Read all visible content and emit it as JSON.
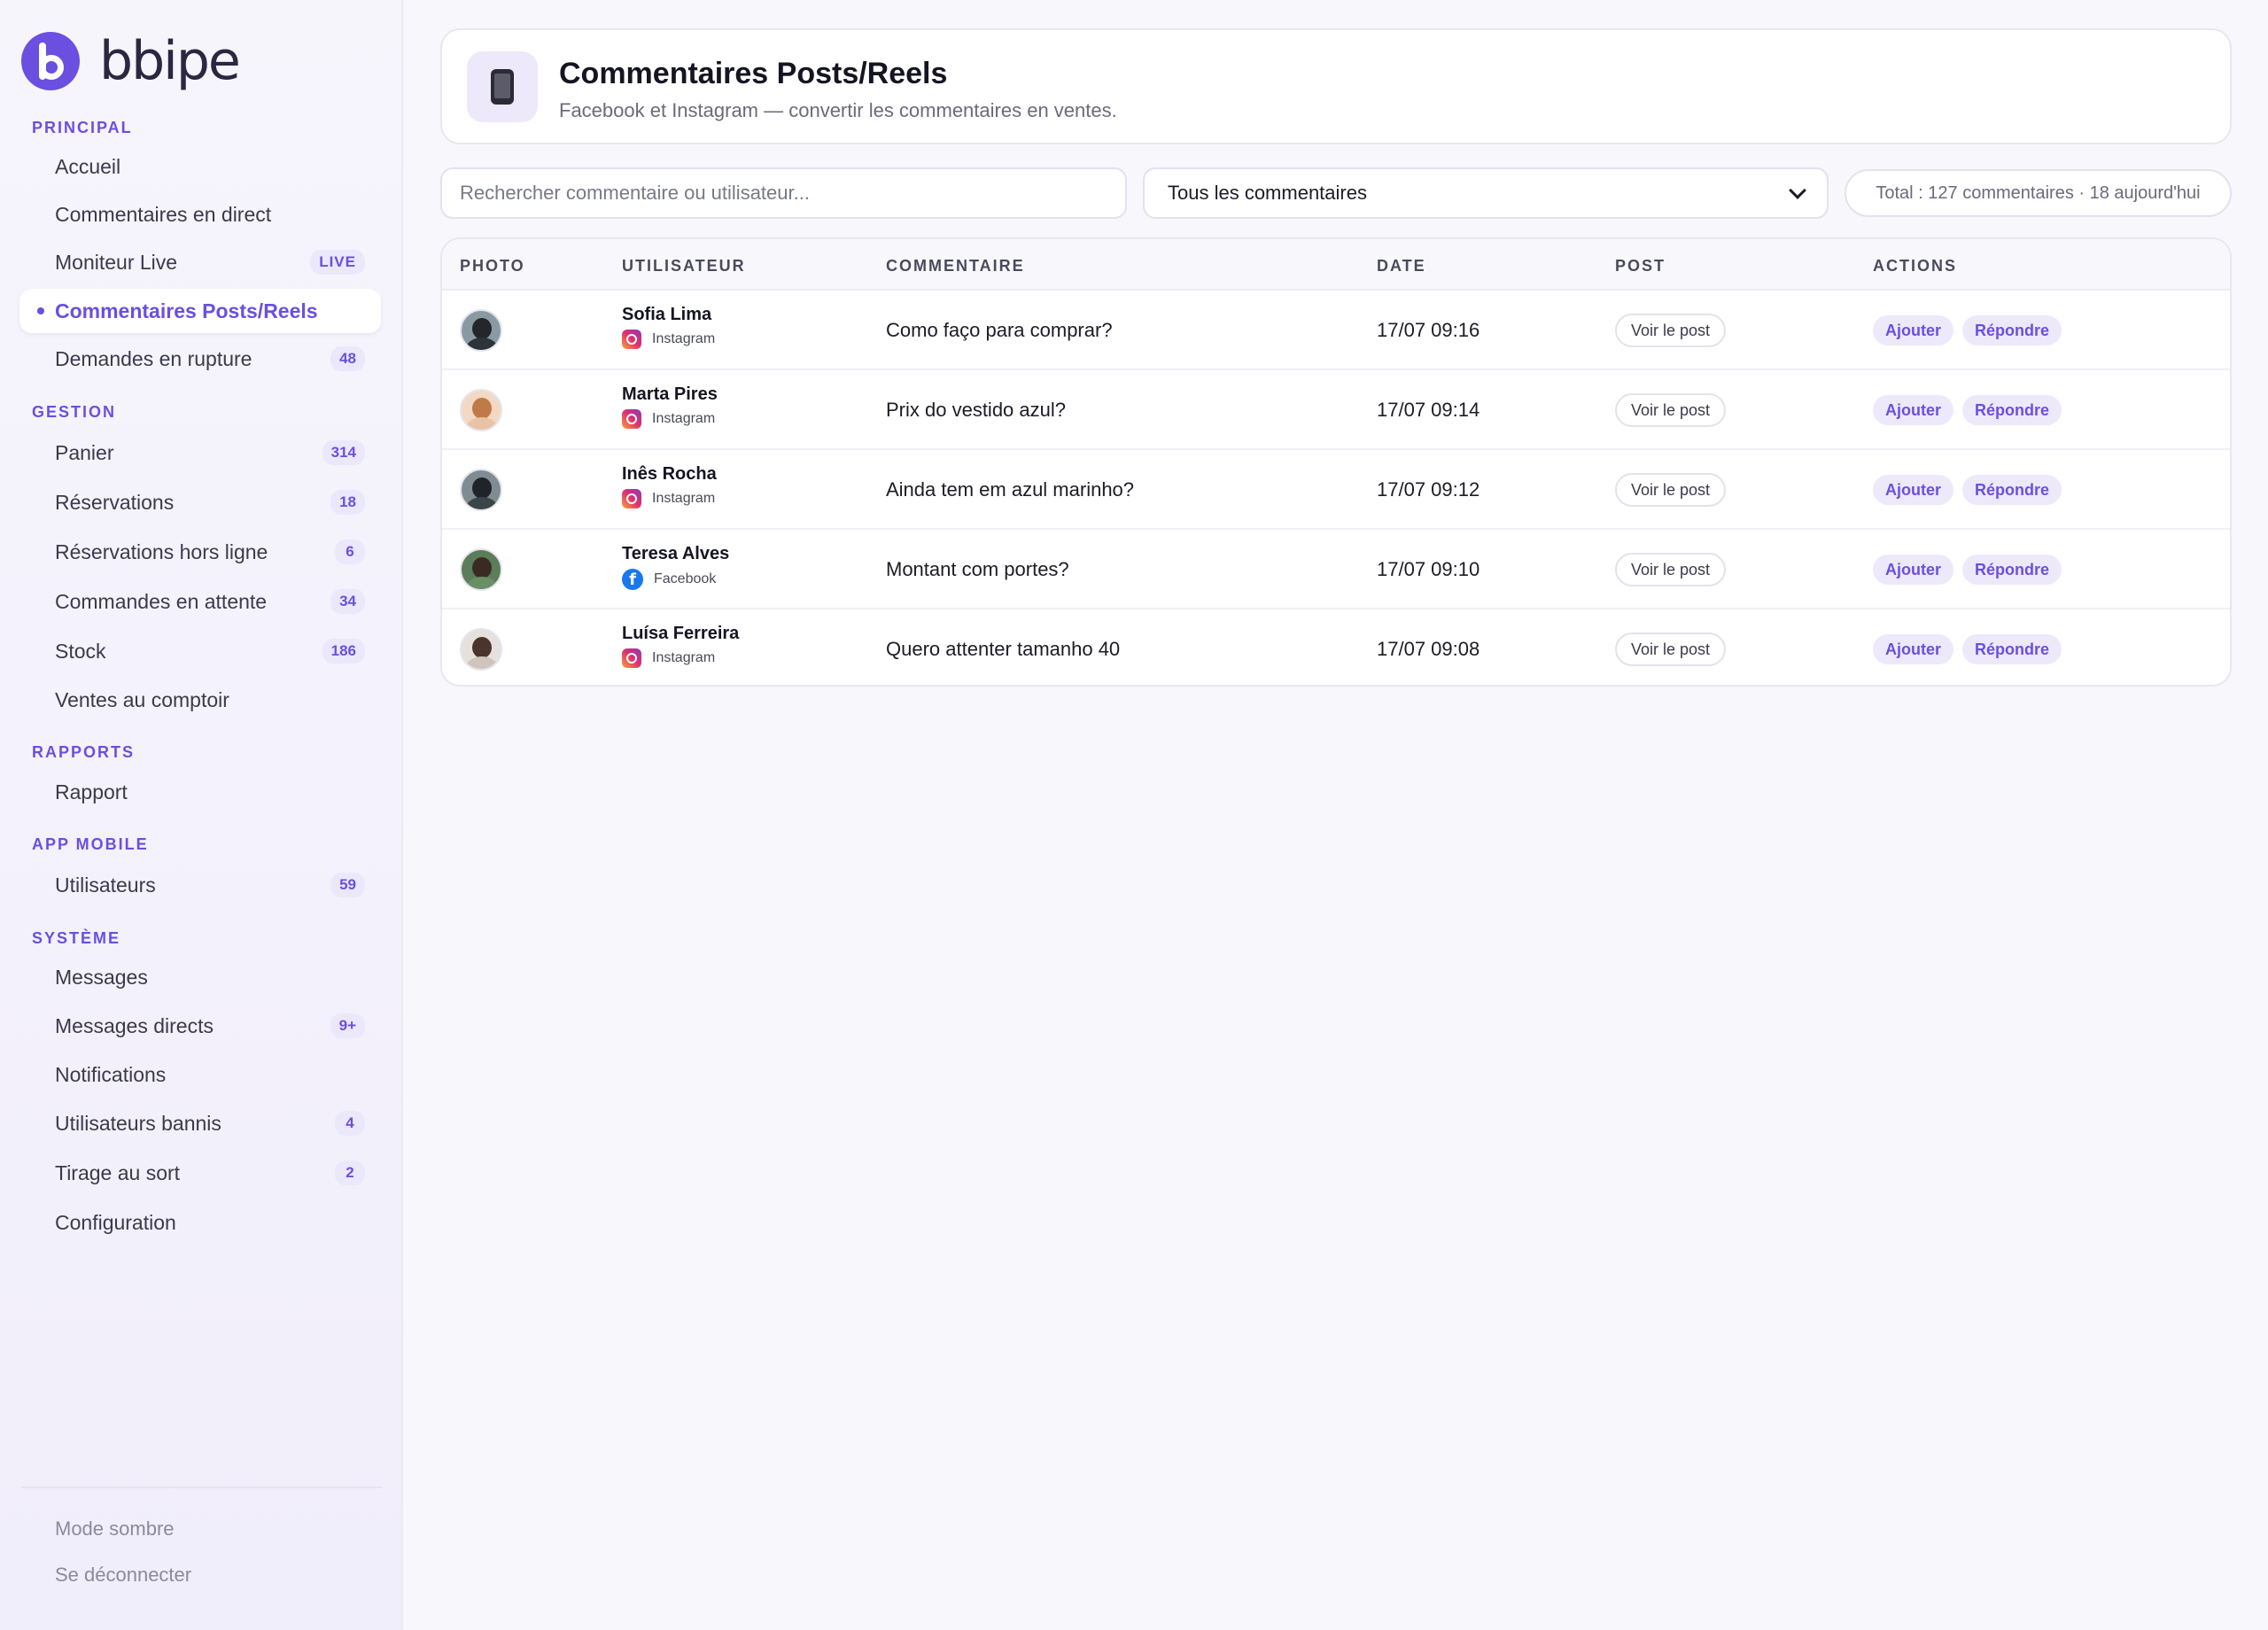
{
  "brand": {
    "name": "bbipe",
    "accent": "#6b4fe0"
  },
  "sidebar": {
    "sections": [
      {
        "label": "PRINCIPAL"
      },
      {
        "label": "GESTION"
      },
      {
        "label": "RAPPORTS"
      },
      {
        "label": "APP MOBILE"
      },
      {
        "label": "SYSTÈME"
      }
    ],
    "items": [
      {
        "label": "Accueil",
        "badge": ""
      },
      {
        "label": "Commentaires en direct",
        "badge": ""
      },
      {
        "label": "Moniteur Live",
        "badge": "LIVE"
      },
      {
        "label": "Commentaires Posts/Reels",
        "badge": "",
        "active": true
      },
      {
        "label": "Demandes en rupture",
        "badge": "48"
      },
      {
        "label": "Panier",
        "badge": "314"
      },
      {
        "label": "Réservations",
        "badge": "18"
      },
      {
        "label": "Réservations hors ligne",
        "badge": "6"
      },
      {
        "label": "Commandes en attente",
        "badge": "34"
      },
      {
        "label": "Stock",
        "badge": "186"
      },
      {
        "label": "Ventes au comptoir",
        "badge": ""
      },
      {
        "label": "Rapport",
        "badge": ""
      },
      {
        "label": "Utilisateurs",
        "badge": "59"
      },
      {
        "label": "Messages",
        "badge": ""
      },
      {
        "label": "Messages directs",
        "badge": "9+"
      },
      {
        "label": "Notifications",
        "badge": ""
      },
      {
        "label": "Utilisateurs bannis",
        "badge": "4"
      },
      {
        "label": "Tirage au sort",
        "badge": "2"
      },
      {
        "label": "Configuration",
        "badge": ""
      }
    ],
    "footer": {
      "dark_mode": "Mode sombre",
      "logout": "Se déconnecter"
    }
  },
  "header": {
    "title": "Commentaires Posts/Reels",
    "subtitle": "Facebook et Instagram — convertir les commentaires en ventes.",
    "icon": "mobile-phone-icon"
  },
  "toolbar": {
    "search_placeholder": "Rechercher commentaire ou utilisateur...",
    "filter_value": "Tous les commentaires",
    "total": "Total : 127 commentaires · 18 aujourd'hui"
  },
  "table": {
    "columns": [
      "PHOTO",
      "UTILISATEUR",
      "COMMENTAIRE",
      "DATE",
      "POST",
      "ACTIONS"
    ],
    "post_button": "Voir le post",
    "action_add": "Ajouter",
    "action_reply": "Répondre",
    "rows": [
      {
        "user": "Sofia Lima",
        "source": "Instagram",
        "comment": "Como faço para comprar?",
        "date": "17/07 09:16"
      },
      {
        "user": "Marta Pires",
        "source": "Instagram",
        "comment": "Prix do vestido azul?",
        "date": "17/07 09:14"
      },
      {
        "user": "Inês Rocha",
        "source": "Instagram",
        "comment": "Ainda tem em azul marinho?",
        "date": "17/07 09:12"
      },
      {
        "user": "Teresa Alves",
        "source": "Facebook",
        "comment": "Montant com portes?",
        "date": "17/07 09:10"
      },
      {
        "user": "Luísa Ferreira",
        "source": "Instagram",
        "comment": "Quero attenter tamanho 40",
        "date": "17/07 09:08"
      }
    ]
  }
}
